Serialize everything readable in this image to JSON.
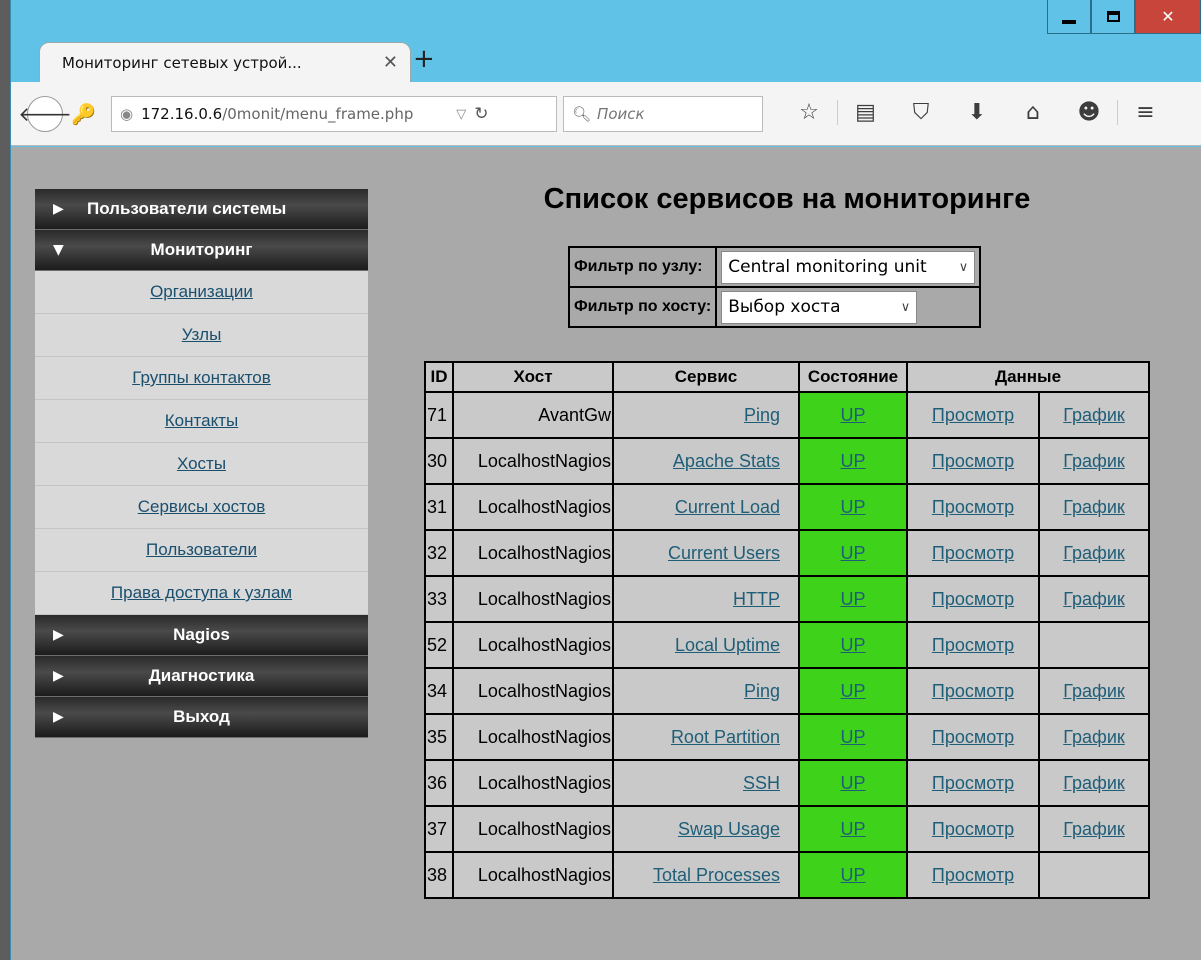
{
  "browser": {
    "tab_title": "Мониторинг сетевых устрой...",
    "tab_close": "✕",
    "new_tab": "+",
    "url_host": "172.16.0.6",
    "url_path": "/0monit/menu_frame.php",
    "search_placeholder": "Поиск",
    "icons": [
      "star-icon",
      "reader-icon",
      "pocket-icon",
      "download-icon",
      "home-icon",
      "chat-icon",
      "menu-icon"
    ]
  },
  "sidebar": {
    "sections": [
      {
        "label": "Пользователи системы",
        "expanded": false
      },
      {
        "label": "Мониторинг",
        "expanded": true
      },
      {
        "label": "Nagios",
        "expanded": false
      },
      {
        "label": "Диагностика",
        "expanded": false
      },
      {
        "label": "Выход",
        "expanded": false
      }
    ],
    "monitoring_items": [
      "Организации",
      "Узлы",
      "Группы контактов",
      "Контакты",
      "Хосты",
      "Сервисы хостов",
      "Пользователи",
      "Права доступа к узлам"
    ]
  },
  "page": {
    "title": "Список сервисов на мониторинге",
    "filter_node_label": "Фильтр по узлу:",
    "filter_node_value": "Central monitoring unit",
    "filter_host_label": "Фильтр по хосту:",
    "filter_host_value": "Выбор хоста"
  },
  "table": {
    "headers": {
      "id": "ID",
      "host": "Хост",
      "service": "Сервис",
      "state": "Состояние",
      "data": "Данные"
    },
    "view_label": "Просмотр",
    "graph_label": "График",
    "rows": [
      {
        "id": "71",
        "host": "AvantGw",
        "service": "Ping",
        "state": "UP",
        "graph": true
      },
      {
        "id": "30",
        "host": "LocalhostNagios",
        "service": "Apache Stats",
        "state": "UP",
        "graph": true
      },
      {
        "id": "31",
        "host": "LocalhostNagios",
        "service": "Current Load",
        "state": "UP",
        "graph": true
      },
      {
        "id": "32",
        "host": "LocalhostNagios",
        "service": "Current Users",
        "state": "UP",
        "graph": true
      },
      {
        "id": "33",
        "host": "LocalhostNagios",
        "service": "HTTP",
        "state": "UP",
        "graph": true
      },
      {
        "id": "52",
        "host": "LocalhostNagios",
        "service": "Local Uptime",
        "state": "UP",
        "graph": false
      },
      {
        "id": "34",
        "host": "LocalhostNagios",
        "service": "Ping",
        "state": "UP",
        "graph": true
      },
      {
        "id": "35",
        "host": "LocalhostNagios",
        "service": "Root Partition",
        "state": "UP",
        "graph": true
      },
      {
        "id": "36",
        "host": "LocalhostNagios",
        "service": "SSH",
        "state": "UP",
        "graph": true
      },
      {
        "id": "37",
        "host": "LocalhostNagios",
        "service": "Swap Usage",
        "state": "UP",
        "graph": true
      },
      {
        "id": "38",
        "host": "LocalhostNagios",
        "service": "Total Processes",
        "state": "UP",
        "graph": false
      }
    ]
  },
  "colors": {
    "state_up": "#3fd21a",
    "link": "#1f5e78",
    "content_bg": "#a9a9a9"
  }
}
